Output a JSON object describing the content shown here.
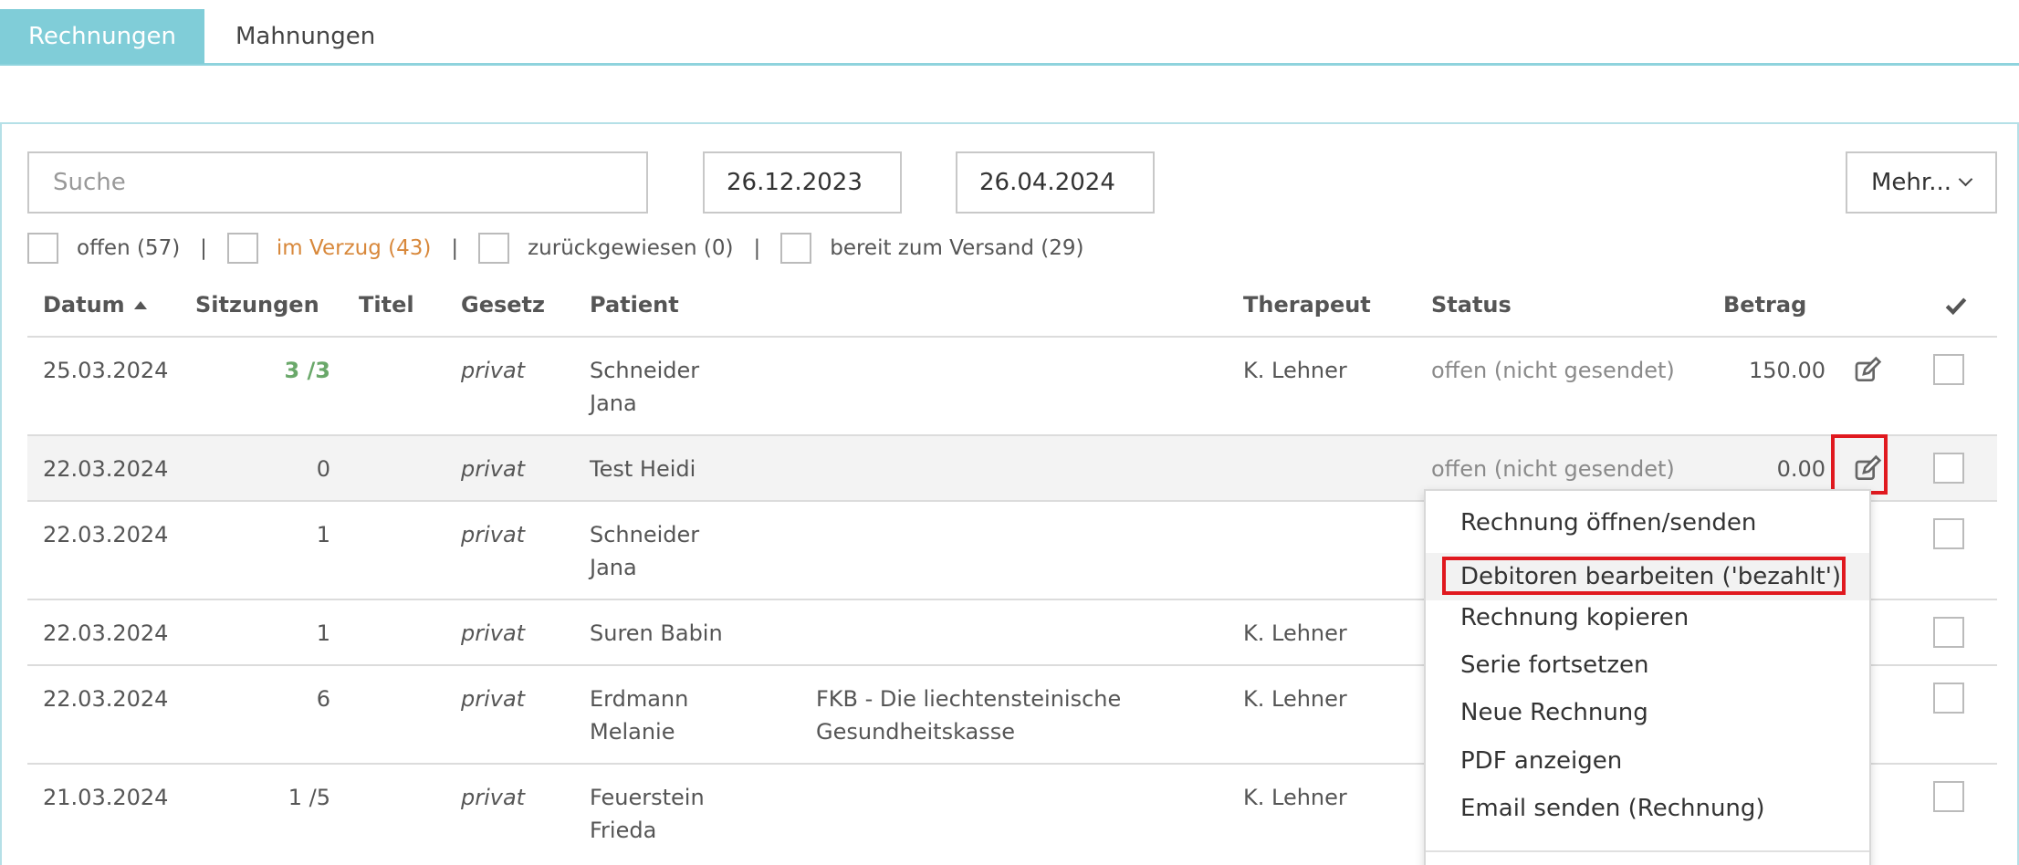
{
  "tabs": [
    {
      "label": "Rechnungen",
      "active": true
    },
    {
      "label": "Mahnungen",
      "active": false
    }
  ],
  "toolbar": {
    "search_placeholder": "Suche",
    "date_from": "26.12.2023",
    "date_to": "26.04.2024",
    "more_label": "Mehr..."
  },
  "filters": [
    {
      "label": "offen (57)",
      "checked": false
    },
    {
      "label": "im Verzug (43)",
      "checked": false,
      "color": "#d8883b"
    },
    {
      "label": "zurückgewiesen (0)",
      "checked": false
    },
    {
      "label": "bereit zum Versand (29)",
      "checked": false
    }
  ],
  "filter_separator": "|",
  "table": {
    "columns": {
      "date": "Datum",
      "sessions": "Sitzungen",
      "title": "Titel",
      "law": "Gesetz",
      "patient": "Patient",
      "therapist": "Therapeut",
      "status": "Status",
      "amount": "Betrag"
    },
    "rows": [
      {
        "date": "25.03.2024",
        "sessions": "3 /3",
        "law": "privat",
        "patient": "Schneider\nJana",
        "insurer": "",
        "therapist": "K. Lehner",
        "status": "offen (nicht gesendet)",
        "amount": "150.00"
      },
      {
        "date": "22.03.2024",
        "sessions": "0",
        "law": "privat",
        "patient": "Test Heidi",
        "insurer": "",
        "therapist": "",
        "status": "offen (nicht gesendet)",
        "amount": "0.00"
      },
      {
        "date": "22.03.2024",
        "sessions": "1",
        "law": "privat",
        "patient": "Schneider\nJana",
        "insurer": "",
        "therapist": "",
        "status": "",
        "amount": ""
      },
      {
        "date": "22.03.2024",
        "sessions": "1",
        "law": "privat",
        "patient": "Suren Babin",
        "insurer": "",
        "therapist": "K. Lehner",
        "status": "",
        "amount": ""
      },
      {
        "date": "22.03.2024",
        "sessions": "6",
        "law": "privat",
        "patient": "Erdmann\nMelanie",
        "insurer": "FKB - Die liechtensteinische\nGesundheitskasse",
        "therapist": "K. Lehner",
        "status": "",
        "amount": ""
      },
      {
        "date": "21.03.2024",
        "sessions": "1 /5",
        "law": "privat",
        "patient": "Feuerstein\nFrieda",
        "insurer": "",
        "therapist": "K. Lehner",
        "status": "",
        "amount": ""
      }
    ]
  },
  "context_menu": {
    "items": [
      "Rechnung öffnen/senden",
      "Debitoren bearbeiten ('bezahlt')",
      "Rechnung kopieren",
      "Serie fortsetzen",
      "Neue Rechnung",
      "PDF anzeigen",
      "Email senden (Rechnung)"
    ]
  },
  "colors": {
    "accent": "#80cdd8",
    "highlight": "#e0191f",
    "sessions_complete": "#6aa86a"
  }
}
